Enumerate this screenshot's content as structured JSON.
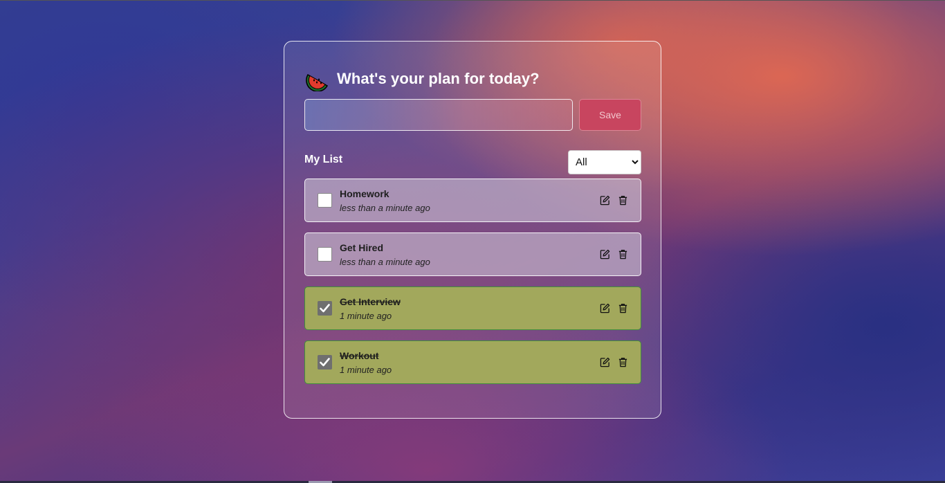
{
  "header": {
    "title": "What's your plan for today?",
    "logo_icon": "watermelon-icon"
  },
  "form": {
    "input_value": "",
    "input_placeholder": "",
    "save_label": "Save"
  },
  "list": {
    "heading": "My List",
    "filter_selected": "All",
    "items": [
      {
        "title": "Homework",
        "time": "less than a minute ago",
        "completed": false
      },
      {
        "title": "Get Hired",
        "time": "less than a minute ago",
        "completed": false
      },
      {
        "title": "Get Interview",
        "time": "1 minute ago",
        "completed": true
      },
      {
        "title": "Workout",
        "time": "1 minute ago",
        "completed": true
      }
    ]
  },
  "colors": {
    "save_button": "#c8455f",
    "completed_item": "#a2a85c",
    "completed_border": "#3f8f3b"
  }
}
